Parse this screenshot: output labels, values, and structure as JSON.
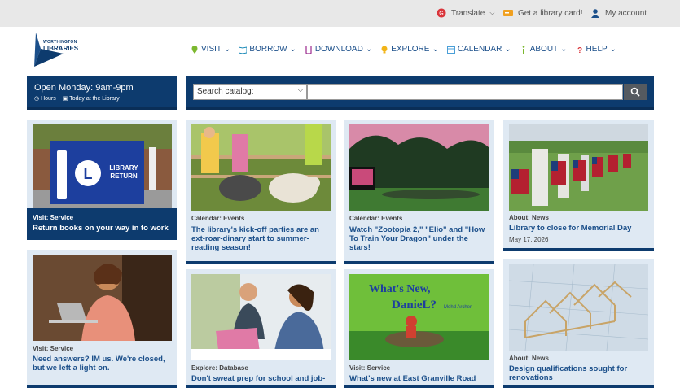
{
  "utility": {
    "translate": "Translate",
    "library_card": "Get a library card!",
    "account": "My account"
  },
  "logo": {
    "line1": "WORTHINGTON",
    "line2": "LIBRARIES"
  },
  "nav": [
    {
      "label": "VISIT",
      "icon": "map-pin-icon"
    },
    {
      "label": "BORROW",
      "icon": "book-icon"
    },
    {
      "label": "DOWNLOAD",
      "icon": "tablet-icon"
    },
    {
      "label": "EXPLORE",
      "icon": "lightbulb-icon"
    },
    {
      "label": "CALENDAR",
      "icon": "calendar-icon"
    },
    {
      "label": "ABOUT",
      "icon": "info-icon"
    },
    {
      "label": "HELP",
      "icon": "question-icon"
    }
  ],
  "hours": {
    "title": "Open Monday: 9am-9pm",
    "hours_link": "Hours",
    "today_link": "Today at the Library"
  },
  "search": {
    "selected": "Search catalog:",
    "placeholder": ""
  },
  "cards": [
    {
      "category": "Visit: Service",
      "title": "Return books on your way in to work",
      "date": ""
    },
    {
      "category": "Calendar: Events",
      "title": "The library's kick-off parties are an ext-roar-dinary start to summer-reading season!",
      "date": ""
    },
    {
      "category": "Calendar: Events",
      "title": "Watch \"Zootopia 2,\" \"Elio\" and \"How To Train Your Dragon\" under the stars!",
      "date": ""
    },
    {
      "category": "About: News",
      "title": "Library to close for Memorial Day",
      "date": "May 17, 2026"
    },
    {
      "category": "Visit: Service",
      "title": "Need answers? IM us. We're closed, but we left a light on.",
      "date": ""
    },
    {
      "category": "Explore: Database",
      "title": "Don't sweat prep for school and job-",
      "date": ""
    },
    {
      "category": "Visit: Service",
      "title": "What's new at East Granville Road",
      "date": ""
    },
    {
      "category": "About: News",
      "title": "Design qualifications sought for renovations",
      "date": ""
    }
  ],
  "book_cover": {
    "title": "What's New, Daniel?",
    "author": "Mohd Archer"
  },
  "return_bin_text": "LIBRARY RETURN",
  "colors": {
    "navy": "#0d3b6e",
    "link": "#1b4f8a",
    "card_bg": "#dfe9f3"
  }
}
